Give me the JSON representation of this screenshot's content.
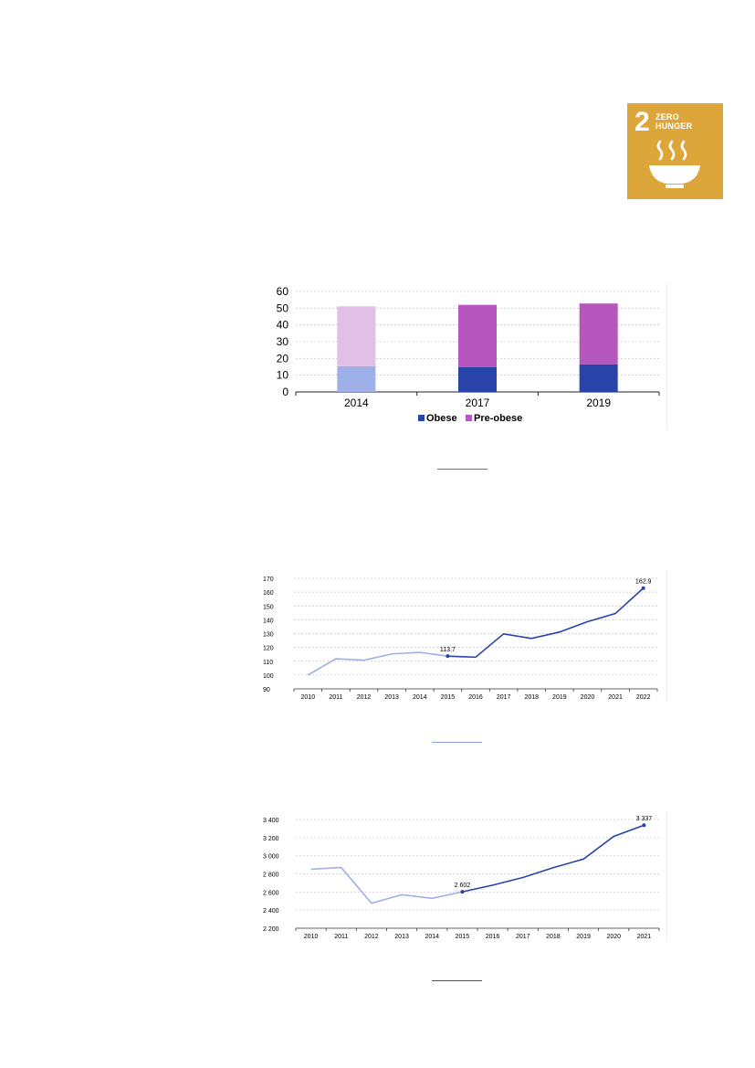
{
  "sdg_badge": {
    "number": "2",
    "title": "ZERO HUNGER",
    "color": "#DDA63A",
    "icon": "bowl-icon"
  },
  "chart_data": [
    {
      "type": "bar",
      "stacked": true,
      "categories": [
        "2014",
        "2017",
        "2019"
      ],
      "series": [
        {
          "name": "Obese",
          "values": [
            15.3,
            14.9,
            16.5
          ],
          "colors": [
            "#9FB0E8",
            "#2844A8",
            "#2844A8"
          ]
        },
        {
          "name": "Pre-obese",
          "values": [
            35.8,
            37.1,
            36.3
          ],
          "colors": [
            "#E2BFE6",
            "#B657C0",
            "#B657C0"
          ]
        }
      ],
      "ylim": [
        0,
        60
      ],
      "yticks": [
        0,
        10,
        20,
        30,
        40,
        50,
        60
      ],
      "grid": true,
      "legend": "bottom"
    },
    {
      "type": "line",
      "x": [
        "2010",
        "2011",
        "2012",
        "2013",
        "2014",
        "2015",
        "2016",
        "2017",
        "2018",
        "2019",
        "2020",
        "2021",
        "2022"
      ],
      "values": [
        100,
        111.8,
        110.7,
        115.3,
        116.4,
        113.7,
        112.9,
        129.8,
        126.5,
        131.1,
        138.6,
        144.5,
        162.9
      ],
      "highlight_from": "2015",
      "colors": {
        "before": "#9FB0E8",
        "after": "#2844A8"
      },
      "labels": [
        {
          "x": "2015",
          "text": "113.7"
        },
        {
          "x": "2022",
          "text": "162.9"
        }
      ],
      "ylim": [
        90,
        170
      ],
      "yticks": [
        90,
        100,
        110,
        120,
        130,
        140,
        150,
        160,
        170
      ],
      "grid": true
    },
    {
      "type": "line",
      "x": [
        "2010",
        "2011",
        "2012",
        "2013",
        "2014",
        "2015",
        "2016",
        "2017",
        "2018",
        "2019",
        "2020",
        "2021"
      ],
      "values": [
        2851,
        2871,
        2476,
        2570,
        2530,
        2602,
        2675,
        2760,
        2868,
        2963,
        3214,
        3337
      ],
      "highlight_from": "2015",
      "colors": {
        "before": "#9FB0E8",
        "after": "#2844A8"
      },
      "labels": [
        {
          "x": "2015",
          "text": "2 602"
        },
        {
          "x": "2021",
          "text": "3 337"
        }
      ],
      "ylim": [
        2200,
        3400
      ],
      "yticks": [
        2200,
        2400,
        2600,
        2800,
        3000,
        3200,
        3400
      ],
      "ytick_labels": [
        "2 200",
        "2 400",
        "2 600",
        "2 800",
        "3 000",
        "3 200",
        "3 400"
      ],
      "grid": true
    }
  ]
}
